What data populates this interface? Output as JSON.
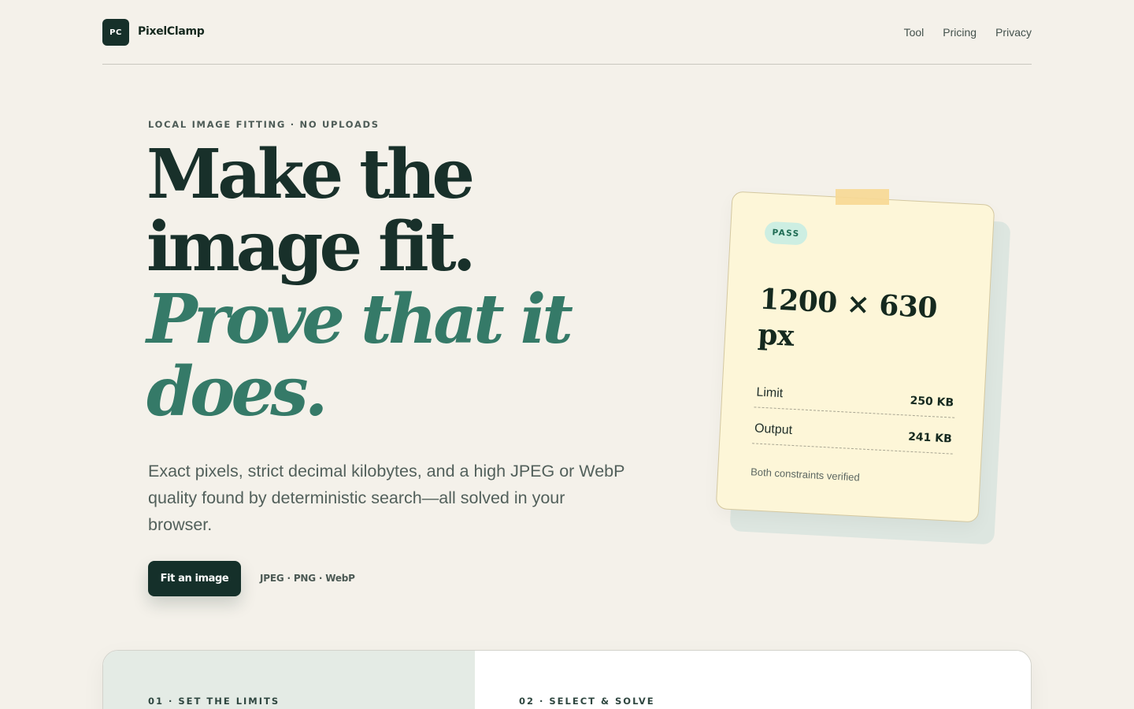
{
  "header": {
    "logo_badge": "PC",
    "brand": "PixelClamp",
    "nav": [
      {
        "label": "Tool"
      },
      {
        "label": "Pricing"
      },
      {
        "label": "Privacy"
      }
    ]
  },
  "hero": {
    "eyebrow": "LOCAL IMAGE FITTING · NO UPLOADS",
    "headline_lines": [
      "Make the",
      "image fit.",
      "Prove that it",
      "does."
    ],
    "lead": "Exact pixels, strict decimal kilobytes, and a high JPEG or WebP quality found by deterministic search—all solved in your browser.",
    "cta_label": "Fit an image",
    "formats": "JPEG · PNG · WebP"
  },
  "card": {
    "status_badge": "PASS",
    "dimensions": "1200 × 630 px",
    "rows": [
      {
        "key": "Limit",
        "value": "250 KB"
      },
      {
        "key": "Output",
        "value": "241 KB"
      }
    ],
    "note": "Both constraints verified"
  },
  "steps": [
    {
      "label": "01 · SET THE LIMITS"
    },
    {
      "label": "02 · SELECT & SOLVE"
    }
  ],
  "colors": {
    "background": "#f4f1ea",
    "ink": "#18302a",
    "accent": "#357a68",
    "card_bg": "#fdf6d8",
    "pass_bg": "#cdeee2"
  }
}
